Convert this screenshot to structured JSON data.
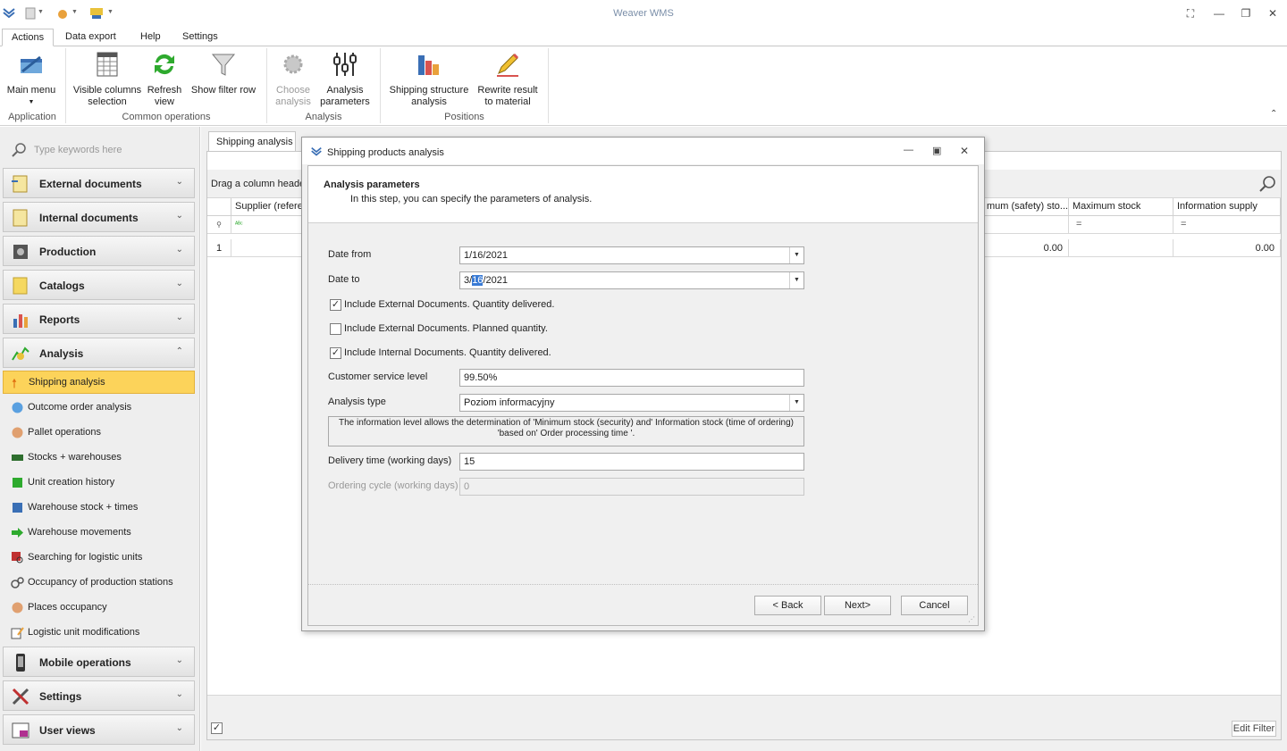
{
  "app": {
    "title": "Weaver WMS"
  },
  "ribbon_tabs": [
    "Actions",
    "Data export",
    "Help",
    "Settings"
  ],
  "ribbon": {
    "application": {
      "label": "Application",
      "main_menu": "Main menu"
    },
    "common": {
      "label": "Common operations",
      "visible_columns_1": "Visible columns",
      "visible_columns_2": "selection",
      "refresh_1": "Refresh",
      "refresh_2": "view",
      "show_filter_row": "Show filter row"
    },
    "analysis": {
      "label": "Analysis",
      "choose_1": "Choose",
      "choose_2": "analysis",
      "params_1": "Analysis",
      "params_2": "parameters"
    },
    "positions": {
      "label": "Positions",
      "shipping_structure_1": "Shipping structure",
      "shipping_structure_2": "analysis",
      "rewrite_1": "Rewrite result",
      "rewrite_2": "to material"
    }
  },
  "search": {
    "placeholder": "Type keywords here"
  },
  "nav_groups": {
    "external": "External documents",
    "internal": "Internal documents",
    "production": "Production",
    "catalogs": "Catalogs",
    "reports": "Reports",
    "analysis": "Analysis",
    "mobile": "Mobile operations",
    "settings": "Settings",
    "user_views": "User views"
  },
  "analysis_items": [
    "Shipping analysis",
    "Outcome order analysis",
    "Pallet operations",
    "Stocks + warehouses",
    "Unit creation history",
    "Warehouse stock + times",
    "Warehouse movements",
    "Searching for logistic units",
    "Occupancy of production stations",
    "Places occupancy",
    "Logistic unit modifications"
  ],
  "document": {
    "tab": "Shipping analysis",
    "group_hint": "Drag a column heade",
    "columns": {
      "supplier": "Supplier (refere",
      "min_stock": "mum (safety) sto...",
      "max_stock": "Maximum stock",
      "info_supply": "Information supply"
    },
    "filter_eq": "=",
    "row_num": "1",
    "row_min": "0.00",
    "row_info": "0.00",
    "edit_filter": "Edit Filter"
  },
  "dialog": {
    "title": "Shipping products analysis",
    "header": "Analysis parameters",
    "subheader": "In this step, you can specify the parameters of analysis.",
    "date_from_label": "Date from",
    "date_from": "1/16/2021",
    "date_to_label": "Date to",
    "date_to_a": "3/",
    "date_to_b": "16",
    "date_to_c": "/2021",
    "chk1": "Include External Documents. Quantity delivered.",
    "chk2": "Include External Documents. Planned quantity.",
    "chk3": "Include Internal Documents. Quantity delivered.",
    "service_level_label": "Customer service level",
    "service_level": "99.50%",
    "analysis_type_label": "Analysis type",
    "analysis_type": "Poziom informacyjny",
    "info_1": "The information level allows the determination of 'Minimum stock (security) and' Information stock (time of ordering)",
    "info_2": "'based on' Order processing time '.",
    "delivery_label": "Delivery time (working days)",
    "delivery": "15",
    "ordering_label": "Ordering cycle (working days)",
    "ordering": "0",
    "back": "< Back",
    "next": "Next>",
    "cancel": "Cancel"
  },
  "colors": {
    "selected_nav": "#fcd35a",
    "accent": "#3a7bd5"
  }
}
